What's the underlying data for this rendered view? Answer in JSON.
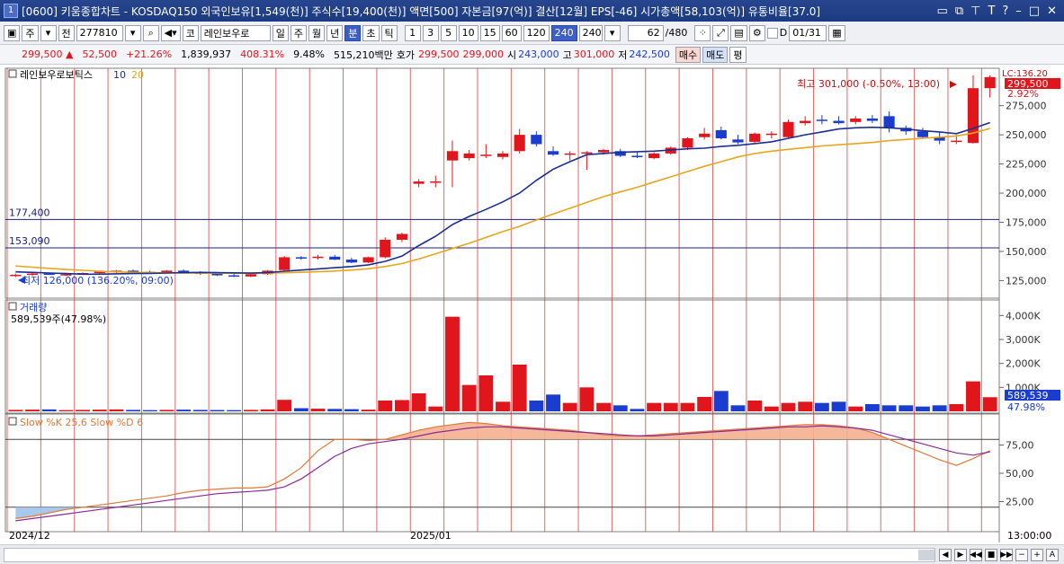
{
  "window": {
    "number": "1",
    "title": "[0600] 키움종합차트 - KOSDAQ150 외국인보유[1,549(천)] 주식수[19,400(천)] 액면[500] 자본금[97(억)] 결산[12월] EPS[-46] 시가총액[58,103(억)] 유통비율[37.0]",
    "controls": [
      "▭",
      "⧉",
      "⊤",
      "T",
      "?",
      "–",
      "□",
      "✕"
    ]
  },
  "toolbar": {
    "market": "주",
    "prev_label": "전",
    "code": "277810",
    "name_btn": "코",
    "stock_name": "레인보우로",
    "periods": [
      "일",
      "주",
      "월",
      "년",
      "분",
      "초",
      "틱"
    ],
    "selected_period": "분",
    "intervals": [
      "1",
      "3",
      "5",
      "10",
      "15",
      "60",
      "120",
      "240"
    ],
    "selected_interval": "240",
    "interval_value": "240",
    "count": "62",
    "count_total": "/480",
    "date": "01/31",
    "d_label": "D"
  },
  "info": {
    "price": "299,500 ▲",
    "change": "52,500",
    "change_pct": "+21.26%",
    "volume": "1,839,937",
    "vol_ratio": "408.31%",
    "turnover": "9.48%",
    "amount": "515,210백만",
    "ask_label": "호가",
    "ask": "299,500",
    "bid": "299,000",
    "open_label": "시",
    "open": "243,000",
    "high_label": "고",
    "high": "301,000",
    "low_label": "저",
    "low": "242,500",
    "buy_label": "매수",
    "sell_label": "매도",
    "avg_label": "평"
  },
  "chart_data": [
    {
      "type": "candlestick",
      "title": "레인보우로보틱스",
      "ma_labels": [
        "10",
        "20"
      ],
      "colors": {
        "up": "#e0161c",
        "down": "#1a3ccf",
        "ma10": "#1b2f8f",
        "ma20": "#e8a51e",
        "hline": "#1b2080"
      },
      "hlines": [
        "177,400",
        "153,090"
      ],
      "hline_values": [
        177400,
        153090
      ],
      "high_note": "최고 301,000 (-0.50%, 13:00)",
      "low_note": "최저 126,000 (136.20%, 09:00)",
      "right_label": "LC:136.20",
      "price_box": "299,500",
      "pct_box": "2.92%",
      "y_ticks": [
        "275,000",
        "250,000",
        "225,000",
        "200,000",
        "175,000",
        "150,000",
        "125,000"
      ],
      "y_values": [
        275000,
        250000,
        225000,
        200000,
        175000,
        150000,
        125000
      ],
      "ylim": [
        113000,
        304000
      ],
      "candles": [
        [
          129000,
          131000,
          128000,
          130000
        ],
        [
          130000,
          132000,
          129000,
          131000
        ],
        [
          131000,
          132000,
          130000,
          130000
        ],
        [
          130000,
          131000,
          129000,
          130500
        ],
        [
          130500,
          132000,
          130000,
          131500
        ],
        [
          131500,
          133000,
          130500,
          132500
        ],
        [
          132500,
          134000,
          131500,
          133500
        ],
        [
          133500,
          134500,
          132000,
          132500
        ],
        [
          132500,
          133500,
          131000,
          132000
        ],
        [
          132000,
          134000,
          131000,
          133500
        ],
        [
          133500,
          134500,
          131000,
          132000
        ],
        [
          132000,
          133000,
          130000,
          131000
        ],
        [
          131000,
          132000,
          129000,
          129500
        ],
        [
          129500,
          131000,
          128000,
          128500
        ],
        [
          128500,
          131000,
          128000,
          130500
        ],
        [
          130500,
          134000,
          130000,
          133500
        ],
        [
          134000,
          146000,
          133000,
          145000
        ],
        [
          145000,
          146000,
          143000,
          144500
        ],
        [
          144500,
          147000,
          143000,
          145500
        ],
        [
          145500,
          147000,
          142500,
          143000
        ],
        [
          143000,
          144500,
          140000,
          140500
        ],
        [
          140500,
          145500,
          140000,
          145000
        ],
        [
          145000,
          162000,
          144000,
          160000
        ],
        [
          160000,
          166000,
          158000,
          165000
        ],
        [
          208000,
          212000,
          205000,
          210000
        ],
        [
          210000,
          215000,
          205000,
          210000
        ],
        [
          228000,
          245000,
          205000,
          236000
        ],
        [
          230000,
          237000,
          228000,
          234000
        ],
        [
          232000,
          242000,
          230000,
          233000
        ],
        [
          231000,
          236000,
          229000,
          234000
        ],
        [
          236000,
          255000,
          234000,
          250000
        ],
        [
          250000,
          253000,
          240000,
          242000
        ],
        [
          236000,
          240000,
          232000,
          233000
        ],
        [
          233000,
          236000,
          228000,
          234000
        ],
        [
          234000,
          236000,
          220000,
          235000
        ],
        [
          235000,
          238000,
          233000,
          237000
        ],
        [
          236000,
          238000,
          231000,
          232000
        ],
        [
          232000,
          235000,
          230000,
          231500
        ],
        [
          230000,
          235000,
          229000,
          234000
        ],
        [
          234000,
          240000,
          233000,
          239000
        ],
        [
          239000,
          248000,
          237000,
          247000
        ],
        [
          248000,
          256000,
          246000,
          251000
        ],
        [
          254000,
          257000,
          246000,
          247000
        ],
        [
          246000,
          250000,
          242000,
          243500
        ],
        [
          244000,
          252000,
          243000,
          251000
        ],
        [
          250000,
          253000,
          247000,
          251000
        ],
        [
          248000,
          263000,
          247000,
          261000
        ],
        [
          260000,
          266000,
          258000,
          262000
        ],
        [
          263000,
          267000,
          259000,
          262000
        ],
        [
          262000,
          266000,
          259000,
          260000
        ],
        [
          261000,
          266000,
          259000,
          264000
        ],
        [
          264000,
          267000,
          260000,
          262000
        ],
        [
          266000,
          270000,
          252000,
          256000
        ],
        [
          256000,
          258000,
          250000,
          253000
        ],
        [
          253000,
          256000,
          247000,
          248000
        ],
        [
          248000,
          252000,
          242000,
          245000
        ],
        [
          245000,
          250000,
          242000,
          245000
        ],
        [
          243000,
          301000,
          242500,
          290000
        ],
        [
          290000,
          301000,
          282000,
          299500
        ]
      ],
      "ma10": [
        132500,
        132000,
        131500,
        131000,
        130500,
        130500,
        130800,
        131000,
        131200,
        131500,
        131800,
        132000,
        131800,
        131600,
        131400,
        131800,
        133000,
        134000,
        135000,
        136000,
        137000,
        138500,
        141500,
        146000,
        155000,
        163000,
        173000,
        180000,
        186000,
        192500,
        200000,
        211000,
        220500,
        227000,
        233000,
        234000,
        235000,
        235500,
        236000,
        237000,
        238000,
        238500,
        240000,
        241000,
        242500,
        244000,
        247000,
        250000,
        252500,
        255000,
        256000,
        256500,
        256000,
        255000,
        253500,
        252500,
        251000,
        255500,
        260500
      ],
      "ma20": [
        137500,
        136500,
        135500,
        134500,
        133800,
        133000,
        132500,
        132000,
        131800,
        131600,
        131500,
        131400,
        131300,
        131300,
        131300,
        131400,
        131700,
        132100,
        132600,
        133200,
        134000,
        135200,
        137000,
        139600,
        143500,
        148000,
        152500,
        157000,
        162000,
        167000,
        171500,
        177000,
        182000,
        187000,
        192000,
        197000,
        201000,
        205000,
        209500,
        214000,
        218500,
        223000,
        227000,
        231000,
        234000,
        236000,
        237500,
        239000,
        240500,
        241500,
        242500,
        243500,
        245000,
        246000,
        247000,
        248000,
        249000,
        251500,
        255500
      ]
    },
    {
      "type": "bar",
      "title": "거래량",
      "note": "589,539주(47.98%)",
      "colors": {
        "up": "#e0161c",
        "down": "#1a3ccf"
      },
      "y_ticks": [
        "4,000K",
        "3,000K",
        "2,000K",
        "1,000K"
      ],
      "y_values": [
        4000000,
        3000000,
        2000000,
        1000000
      ],
      "ylim": [
        0,
        4500000
      ],
      "value_box": "589,539",
      "pct_box": "47.98%",
      "values": [
        60000,
        70000,
        80000,
        50000,
        60000,
        70000,
        80000,
        60000,
        50000,
        60000,
        70000,
        60000,
        55000,
        50000,
        60000,
        80000,
        480000,
        130000,
        110000,
        100000,
        90000,
        70000,
        450000,
        470000,
        750000,
        200000,
        3950000,
        1100000,
        1500000,
        400000,
        1950000,
        450000,
        700000,
        350000,
        1000000,
        350000,
        250000,
        100000,
        350000,
        350000,
        350000,
        600000,
        850000,
        250000,
        450000,
        200000,
        350000,
        400000,
        350000,
        400000,
        200000,
        300000,
        250000,
        250000,
        200000,
        250000,
        300000,
        1250000,
        589539
      ]
    },
    {
      "type": "line",
      "title": "Slow %K 25,6  Slow %D 6",
      "colors": {
        "k": "#e07a3a",
        "d": "#8a2a9a",
        "fill": "#f4b090"
      },
      "y_ticks": [
        "75,00",
        "50,00",
        "25,00"
      ],
      "y_values": [
        75,
        50,
        25
      ],
      "ylim": [
        0,
        100
      ],
      "k": [
        10,
        12,
        15,
        18,
        20,
        22,
        24,
        26,
        28,
        30,
        33,
        35,
        36,
        37,
        37,
        38,
        45,
        55,
        70,
        80,
        80,
        79,
        80,
        84,
        88,
        91,
        93,
        95,
        94,
        92,
        91,
        90,
        89,
        88,
        86,
        84,
        83,
        83,
        84,
        85,
        86,
        87,
        88,
        89,
        90,
        91,
        92,
        93,
        93,
        92,
        90,
        86,
        80,
        74,
        68,
        62,
        57,
        63,
        70
      ],
      "d": [
        8,
        10,
        12,
        14,
        16,
        18,
        20,
        22,
        24,
        26,
        28,
        30,
        32,
        33,
        34,
        35,
        38,
        45,
        55,
        65,
        72,
        76,
        78,
        80,
        83,
        86,
        88,
        90,
        91,
        91,
        90,
        89,
        88,
        87,
        86,
        85,
        84,
        83,
        83,
        84,
        85,
        86,
        87,
        88,
        89,
        90,
        91,
        91,
        92,
        91,
        90,
        88,
        84,
        80,
        76,
        72,
        68,
        66,
        69
      ]
    }
  ],
  "time_axis": {
    "left_label": "2024/12",
    "mid_label": "2025/01",
    "right_label": "13:00:00"
  },
  "bottom_nav": [
    "◀",
    "▶",
    "◀◀",
    "■",
    "▶▶",
    "−",
    "+",
    "A"
  ]
}
